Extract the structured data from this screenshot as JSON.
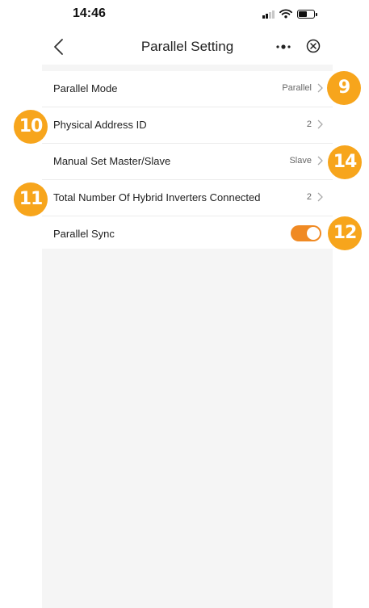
{
  "status_bar": {
    "time": "14:46",
    "signal_icon": "cellular-signal-icon",
    "wifi_icon": "wifi-icon",
    "battery_icon": "battery-icon",
    "battery_level": 0.6
  },
  "nav": {
    "title": "Parallel Setting",
    "back_icon": "chevron-left-icon",
    "more_icon": "more-dots-icon",
    "close_icon": "close-circle-icon"
  },
  "settings": [
    {
      "label": "Parallel Mode",
      "value": "Parallel"
    },
    {
      "label": "Physical Address ID",
      "value": "2"
    },
    {
      "label": "Manual Set Master/Slave",
      "value": "Slave"
    },
    {
      "label": "Total Number Of Hybrid Inverters Connected",
      "value": "2"
    },
    {
      "label": "Parallel Sync",
      "toggle_on": true
    }
  ],
  "callouts": [
    "9",
    "10",
    "14",
    "11",
    "12"
  ],
  "colors": {
    "accent": "#f08a24",
    "callout": "#f7a51c",
    "background": "#f5f5f5"
  }
}
